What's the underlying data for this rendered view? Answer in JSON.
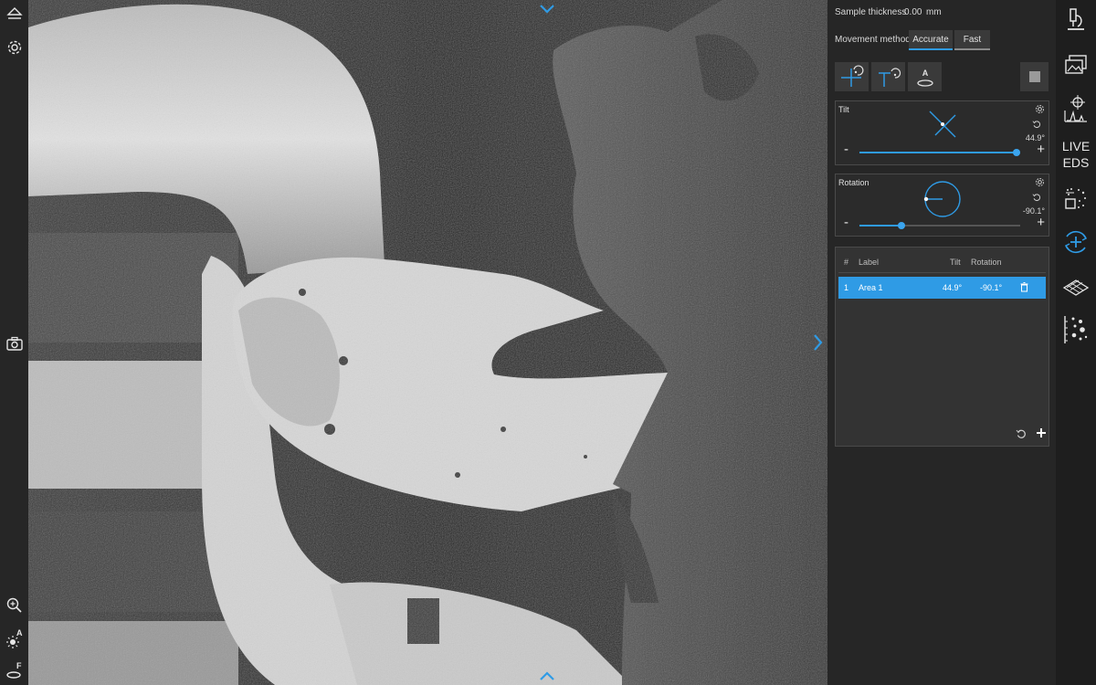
{
  "left_toolbar": {
    "icons": [
      "eject-icon",
      "gear-icon",
      "camera-icon",
      "zoom-in-icon",
      "auto-brightness-icon",
      "auto-focus-icon"
    ],
    "auto_brightness_letter": "A",
    "auto_focus_letter": "F"
  },
  "panel": {
    "sample_thickness": {
      "label": "Sample thickness",
      "value": "0.00",
      "unit": "mm"
    },
    "movement_method": {
      "label": "Movement method",
      "options": [
        "Accurate",
        "Fast"
      ],
      "selected": "Accurate"
    },
    "tools": [
      "eucentric-tilt-icon",
      "eucentric-rotation-icon",
      "auto-height-icon",
      "stop-icon"
    ],
    "auto_height_letter": "A",
    "tilt": {
      "title": "Tilt",
      "value": "44.9°",
      "fraction": 0.98,
      "minus": "-",
      "plus": "+"
    },
    "rotation": {
      "title": "Rotation",
      "value": "-90.1°",
      "fraction": 0.26,
      "minus": "-",
      "plus": "+"
    },
    "table": {
      "headers": {
        "index": "#",
        "label": "Label",
        "tilt": "Tilt",
        "rotation": "Rotation"
      },
      "rows": [
        {
          "index": "1",
          "label": "Area 1",
          "tilt": "44.9°",
          "rotation": "-90.1°"
        }
      ]
    }
  },
  "right_toolbar": {
    "live_eds": {
      "line1": "LIVE",
      "line2": "EDS"
    },
    "icons": [
      "microscope-icon",
      "image-gallery-icon",
      "spectrum-point-icon",
      "live-eds-button",
      "mapping-icon",
      "stage-rotation-icon",
      "surface-3d-icon",
      "particle-analysis-icon"
    ]
  },
  "colors": {
    "accent": "#2f9be5",
    "panel_bg": "#262626",
    "bar_bg": "#1e1e1e"
  }
}
